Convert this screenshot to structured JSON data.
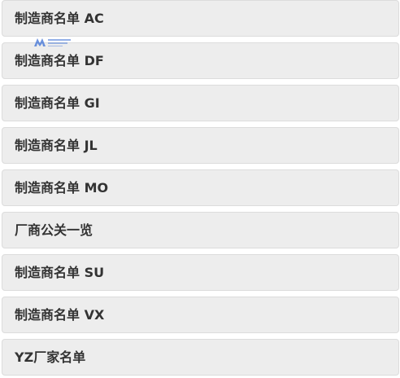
{
  "menu": {
    "items": [
      {
        "label": "制造商名单 AC"
      },
      {
        "label": "制造商名单 DF"
      },
      {
        "label": "制造商名单 GI"
      },
      {
        "label": "制造商名单 JL"
      },
      {
        "label": "制造商名单 MO"
      },
      {
        "label": "厂商公关一览"
      },
      {
        "label": "制造商名单 SU"
      },
      {
        "label": "制造商名单 VX"
      },
      {
        "label": "YZ厂家名单"
      }
    ]
  },
  "colors": {
    "item_background": "#ededed",
    "item_border": "#dcdcdc",
    "text": "#333333",
    "watermark": "#3b6fd4"
  },
  "watermark": {
    "icon": "site-logo-watermark"
  }
}
